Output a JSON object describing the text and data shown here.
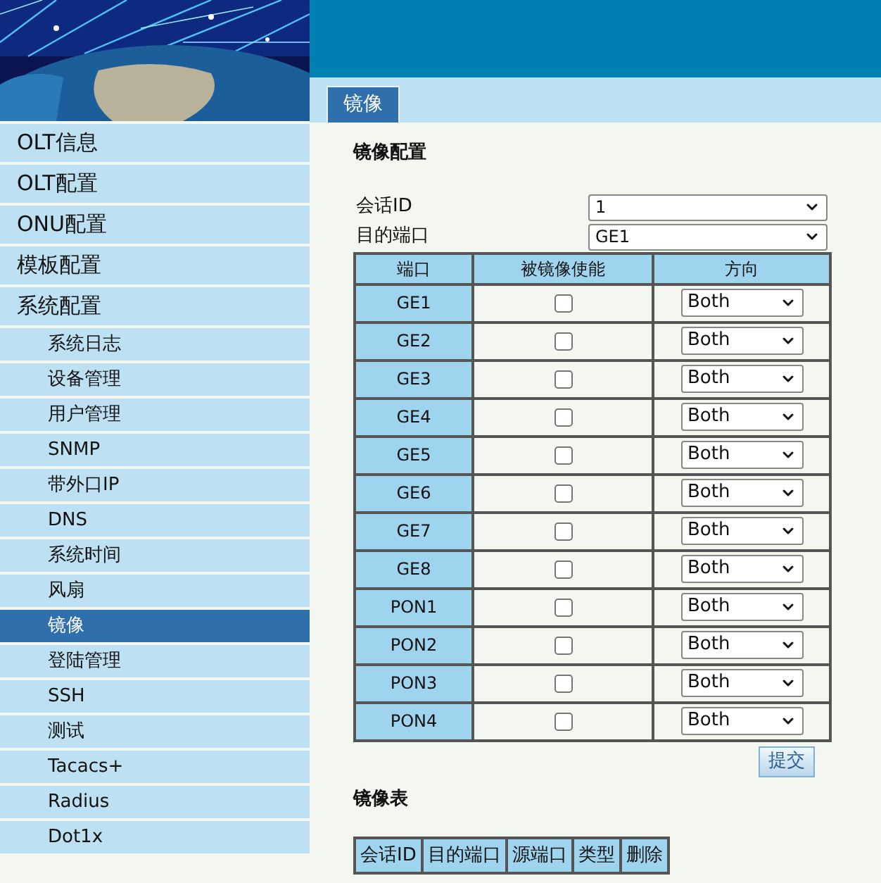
{
  "sidebar": {
    "items": [
      {
        "label": "OLT信息",
        "selected": false
      },
      {
        "label": "OLT配置",
        "selected": false
      },
      {
        "label": "ONU配置",
        "selected": false
      },
      {
        "label": "模板配置",
        "selected": false
      },
      {
        "label": "系统配置",
        "selected": false,
        "children": [
          {
            "label": "系统日志",
            "selected": false
          },
          {
            "label": "设备管理",
            "selected": false
          },
          {
            "label": "用户管理",
            "selected": false
          },
          {
            "label": "SNMP",
            "selected": false
          },
          {
            "label": "带外口IP",
            "selected": false
          },
          {
            "label": "DNS",
            "selected": false
          },
          {
            "label": "系统时间",
            "selected": false
          },
          {
            "label": "风扇",
            "selected": false
          },
          {
            "label": "镜像",
            "selected": true
          },
          {
            "label": "登陆管理",
            "selected": false
          },
          {
            "label": "SSH",
            "selected": false
          },
          {
            "label": "测试",
            "selected": false
          },
          {
            "label": "Tacacs+",
            "selected": false
          },
          {
            "label": "Radius",
            "selected": false
          },
          {
            "label": "Dot1x",
            "selected": false
          }
        ]
      }
    ]
  },
  "tabs": [
    {
      "label": "镜像",
      "selected": true
    }
  ],
  "mirror_config": {
    "title": "镜像配置",
    "fields": [
      {
        "label": "会话ID",
        "value": "1"
      },
      {
        "label": "目的端口",
        "value": "GE1"
      }
    ],
    "columns": [
      "端口",
      "被镜像使能",
      "方向"
    ],
    "rows": [
      {
        "port": "GE1",
        "checked": false,
        "direction": "Both"
      },
      {
        "port": "GE2",
        "checked": false,
        "direction": "Both"
      },
      {
        "port": "GE3",
        "checked": false,
        "direction": "Both"
      },
      {
        "port": "GE4",
        "checked": false,
        "direction": "Both"
      },
      {
        "port": "GE5",
        "checked": false,
        "direction": "Both"
      },
      {
        "port": "GE6",
        "checked": false,
        "direction": "Both"
      },
      {
        "port": "GE7",
        "checked": false,
        "direction": "Both"
      },
      {
        "port": "GE8",
        "checked": false,
        "direction": "Both"
      },
      {
        "port": "PON1",
        "checked": false,
        "direction": "Both"
      },
      {
        "port": "PON2",
        "checked": false,
        "direction": "Both"
      },
      {
        "port": "PON3",
        "checked": false,
        "direction": "Both"
      },
      {
        "port": "PON4",
        "checked": false,
        "direction": "Both"
      }
    ],
    "submit_button": "提交"
  },
  "mirror_table": {
    "title": "镜像表",
    "columns": [
      "会话ID",
      "目的端口",
      "源端口",
      "类型",
      "删除"
    ]
  }
}
